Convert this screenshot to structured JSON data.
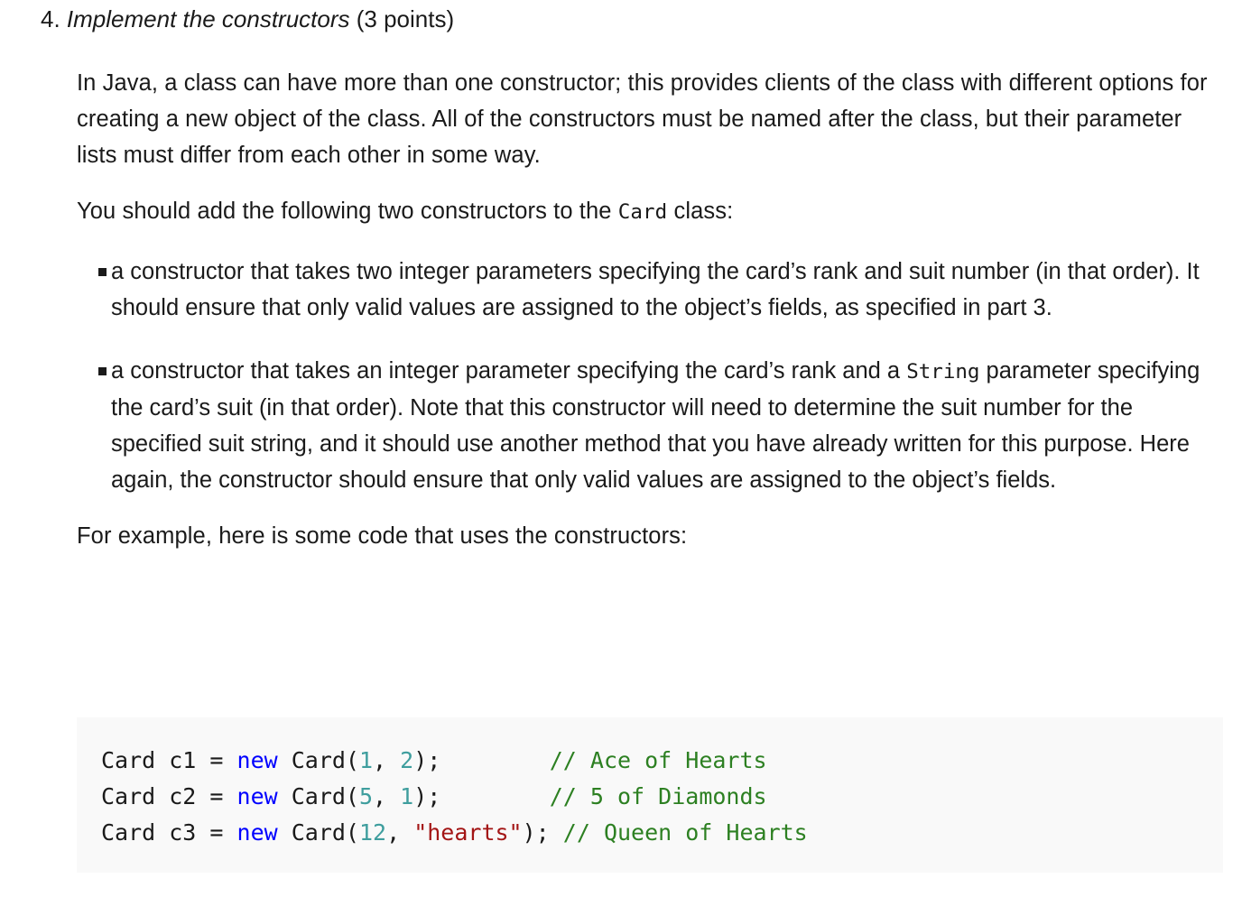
{
  "problem": {
    "number": "4.",
    "title": "Implement the constructors",
    "points": "(3 points)"
  },
  "paragraphs": {
    "intro": "In Java, a class can have more than one constructor; this provides clients of the class with different options for creating a new object of the class. All of the constructors must be named after the class, but their parameter lists must differ from each other in some way.",
    "instruction_before": "You should add the following two constructors to the ",
    "instruction_code": "Card",
    "instruction_after": " class:",
    "example_lead": "For example, here is some code that uses the constructors:"
  },
  "bullets": [
    {
      "marker": "square-bullet",
      "text": "a constructor that takes two integer parameters specifying the card’s rank and suit number (in that order). It should ensure that only valid values are assigned to the object’s fields, as specified in part 3."
    },
    {
      "marker": "square-bullet",
      "lead": "a constructor that takes an integer parameter specifying the card’s rank and a ",
      "code": "String",
      "tail": " parameter specifying the card’s suit (in that order). Note that this constructor will need to determine the suit number for the specified suit string, and it should use another method that you have already written for this purpose. Here again, the constructor should ensure that only valid values are assigned to the object’s fields."
    }
  ],
  "code_block": {
    "background": "#f9f9f9",
    "language": "java",
    "colors": {
      "keyword": "#0000ff",
      "number": "#3f9e9e",
      "string": "#a31515",
      "comment": "#2d8022",
      "plain": "#1a1a1a"
    },
    "lines": [
      {
        "plain_1": "Card c1 = ",
        "keyword": "new",
        "plain_2": " Card(",
        "num_1": "1",
        "plain_3": ", ",
        "num_2": "2",
        "plain_4": ");",
        "spacer": "        ",
        "comment": "// Ace of Hearts"
      },
      {
        "plain_1": "Card c2 = ",
        "keyword": "new",
        "plain_2": " Card(",
        "num_1": "5",
        "plain_3": ", ",
        "num_2": "1",
        "plain_4": ");",
        "spacer": "        ",
        "comment": "// 5 of Diamonds"
      },
      {
        "plain_1": "Card c3 = ",
        "keyword": "new",
        "plain_2": " Card(",
        "num_1": "12",
        "plain_3": ", ",
        "str": "\"hearts\"",
        "plain_4": ");",
        "spacer": " ",
        "comment": "// Queen of Hearts"
      }
    ]
  }
}
